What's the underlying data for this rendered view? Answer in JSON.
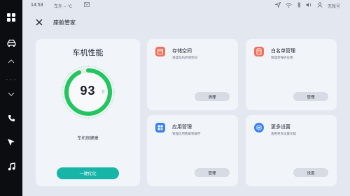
{
  "status_bar": {
    "time": "14:53",
    "weather": "车外 -- °C",
    "user_label": "无账号"
  },
  "dock": {
    "temperature": "- - -",
    "items": [
      "apps-icon",
      "car-icon",
      "chevron-up-icon",
      "chevron-down-icon",
      "phone-icon",
      "navigation-icon",
      "music-icon"
    ]
  },
  "header": {
    "title": "座舱管家"
  },
  "performance": {
    "title": "车机性能",
    "score": "93",
    "score_unit": "分",
    "health_text": "车机很健康",
    "optimize_label": "一键优化",
    "gauge_fraction": 0.93,
    "accent_color": "#22c55e"
  },
  "cards": {
    "storage": {
      "title": "存储空间",
      "desc": "清理车机存储空间",
      "button": "清理",
      "icon": "storage-icon",
      "color": "#f2705a"
    },
    "whitelist": {
      "title": "白名单管理",
      "desc": "管理受保护应用",
      "button": "管理",
      "icon": "whitelist-icon",
      "color": "#f2705a"
    },
    "apps": {
      "title": "应用管理",
      "desc": "管理应用数据和缓存",
      "button": "管理",
      "icon": "apps-manage-icon",
      "color": "#3b82f6"
    },
    "more": {
      "title": "更多设置",
      "desc": "查看更多设置功能",
      "button": "设置",
      "icon": "settings-icon",
      "color": "#3b82f6"
    }
  },
  "colors": {
    "button_primary": "#17b5a8",
    "dock_bg": "#0c0d10",
    "page_bg": "#e3e8f0"
  }
}
